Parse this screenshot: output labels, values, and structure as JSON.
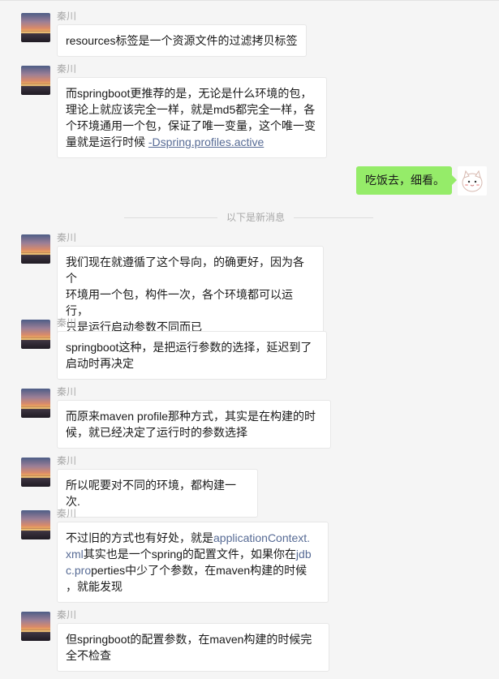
{
  "sender_name": "秦川",
  "messages": [
    {
      "lines": [
        "resources标签是一个资源文件的过滤拷贝标签"
      ]
    },
    {
      "lines": [
        "而springboot更推荐的是，无论是什么环境的包，",
        "理论上就应该完全一样，就是md5都完全一样，各",
        "个环境通用一个包，保证了唯一变量，这个唯一变"
      ],
      "last_prefix": "量就是运行时候 ",
      "last_link": "-Dspring.profiles.active"
    },
    {
      "lines": [
        "我们现在就遵循了这个导向，的确更好，因为各个",
        "环境用一个包，构件一次，各个环境都可以运行，",
        "只是运行启动参数不同而已"
      ]
    },
    {
      "lines": [
        "springboot这种，是把运行参数的选择，延迟到了",
        "启动时再决定"
      ]
    },
    {
      "lines": [
        "而原来maven profile那种方式，其实是在构建的时",
        "候，就已经决定了运行时的参数选择"
      ]
    },
    {
      "lines": [
        "所以呢要对不同的环境，都构建一次."
      ]
    },
    {
      "l1_prefix": "不过旧的方式也有好处，就是",
      "l1_hl": "applicationContext.",
      "l2_hl": "xml",
      "l2_mid": "其实也是一个spring的配置文件，如果你在",
      "l2_hl2": "jdb",
      "l3_hl": "c.pro",
      "l3_rest": "perties中少了个参数，在maven构建的时候",
      "l4": "，就能发现"
    },
    {
      "lines": [
        "但springboot的配置参数，在maven构建的时候完",
        "全不检查"
      ]
    }
  ],
  "self_message": "吃饭去，细看。",
  "divider_text": "以下是新消息",
  "icons": {
    "avatar": "sunset-avatar-icon",
    "self_avatar": "cartoon-avatar-icon"
  }
}
